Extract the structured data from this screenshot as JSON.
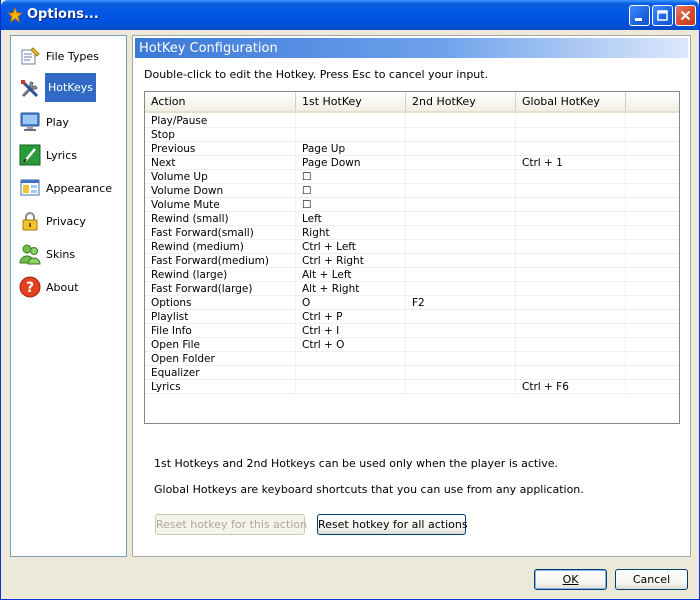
{
  "window": {
    "title": "Options...",
    "colors": {
      "titlebar": "#0056e6",
      "selection": "#316ac5",
      "panel_header": "#3979d6"
    }
  },
  "sidebar": {
    "items": [
      {
        "label": "File Types",
        "icon": "file-types-icon",
        "active": false
      },
      {
        "label": "HotKeys",
        "icon": "tools-icon",
        "active": true
      },
      {
        "label": "Play",
        "icon": "monitor-icon",
        "active": false
      },
      {
        "label": "Lyrics",
        "icon": "pen-icon",
        "active": false
      },
      {
        "label": "Appearance",
        "icon": "appearance-icon",
        "active": false
      },
      {
        "label": "Privacy",
        "icon": "lock-icon",
        "active": false
      },
      {
        "label": "Skins",
        "icon": "people-icon",
        "active": false
      },
      {
        "label": "About",
        "icon": "question-icon",
        "active": false
      }
    ]
  },
  "panel": {
    "header": "HotKey Configuration",
    "instructions": "Double-click to edit the Hotkey. Press Esc to cancel your input.",
    "table": {
      "columns": [
        "Action",
        "1st HotKey",
        "2nd HotKey",
        "Global HotKey"
      ],
      "rows": [
        [
          "Play/Pause",
          "",
          "",
          ""
        ],
        [
          "Stop",
          "",
          "",
          ""
        ],
        [
          "Previous",
          "Page Up",
          "",
          ""
        ],
        [
          "Next",
          "Page Down",
          "",
          "Ctrl + 1"
        ],
        [
          "Volume Up",
          "☐",
          "",
          ""
        ],
        [
          "Volume Down",
          "☐",
          "",
          ""
        ],
        [
          "Volume Mute",
          "☐",
          "",
          ""
        ],
        [
          "Rewind (small)",
          "Left",
          "",
          ""
        ],
        [
          "Fast Forward(small)",
          "Right",
          "",
          ""
        ],
        [
          "Rewind (medium)",
          "Ctrl + Left",
          "",
          ""
        ],
        [
          "Fast Forward(medium)",
          "Ctrl + Right",
          "",
          ""
        ],
        [
          "Rewind (large)",
          "Alt + Left",
          "",
          ""
        ],
        [
          "Fast Forward(large)",
          "Alt + Right",
          "",
          ""
        ],
        [
          "Options",
          "O",
          "F2",
          ""
        ],
        [
          "Playlist",
          "Ctrl + P",
          "",
          ""
        ],
        [
          "File Info",
          "Ctrl + I",
          "",
          ""
        ],
        [
          "Open File",
          "Ctrl + O",
          "",
          ""
        ],
        [
          "Open Folder",
          "",
          "",
          ""
        ],
        [
          "Equalizer",
          "",
          "",
          ""
        ],
        [
          "Lyrics",
          "",
          "",
          "Ctrl + F6"
        ]
      ]
    },
    "note1": "1st Hotkeys and 2nd Hotkeys can be used only when the player is active.",
    "note2": "Global Hotkeys are keyboard shortcuts that you can use from any application.",
    "reset_one_label": "Reset hotkey for this action",
    "reset_all_label": "Reset hotkey for all actions"
  },
  "footer": {
    "ok_label": "OK",
    "cancel_label": "Cancel"
  }
}
